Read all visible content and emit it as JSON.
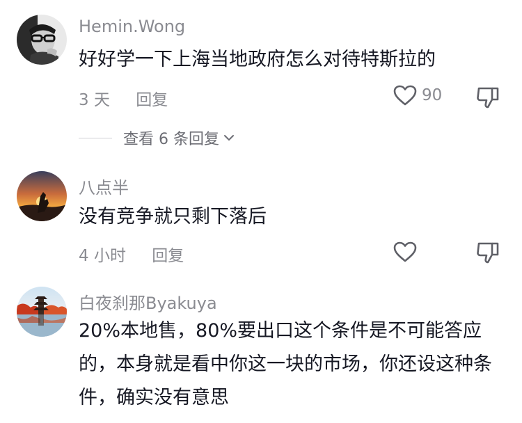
{
  "comments": [
    {
      "username": "Hemin.Wong",
      "text": "好好学一下上海当地政府怎么对待特斯拉的",
      "time": "3 天",
      "reply_label": "回复",
      "like_count": "90",
      "view_replies_label": "查看 6 条回复",
      "avatar_icon": "avatar-man-with-glasses"
    },
    {
      "username": "八点半",
      "text": "没有竞争就只剩下落后",
      "time": "4 小时",
      "reply_label": "回复",
      "like_count": "",
      "avatar_icon": "avatar-sunset-hand"
    },
    {
      "username": "白夜刹那Byakuya",
      "text": "20%本地售，80%要出口这个条件是不可能答应的，本身就是看中你这一块的市场，你还设这种条件，确实没有意思",
      "avatar_icon": "avatar-pagoda-autumn"
    }
  ],
  "colors": {
    "text": "#161823",
    "secondary": "#8a8b91",
    "icon": "#5f6067"
  }
}
